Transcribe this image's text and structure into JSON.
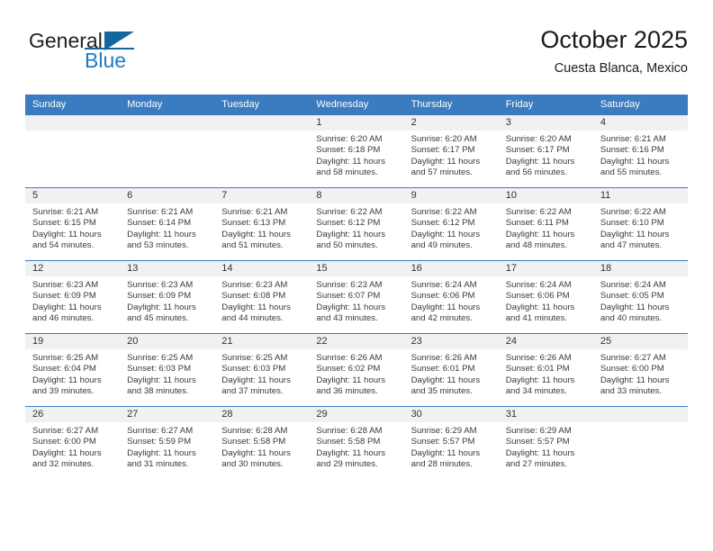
{
  "brand": {
    "name_part1": "General",
    "name_part2": "Blue",
    "flag_icon": "triangle-flag-icon"
  },
  "header": {
    "month_title": "October 2025",
    "location": "Cuesta Blanca, Mexico"
  },
  "colors": {
    "header_blue": "#3b7bbf",
    "brand_blue": "#1f7ac4",
    "daynum_strip": "#f1f1f1",
    "text": "#3a3a3a"
  },
  "weekday_headers": [
    "Sunday",
    "Monday",
    "Tuesday",
    "Wednesday",
    "Thursday",
    "Friday",
    "Saturday"
  ],
  "weeks": [
    [
      {
        "day": "",
        "empty": true
      },
      {
        "day": "",
        "empty": true
      },
      {
        "day": "",
        "empty": true
      },
      {
        "day": "1",
        "sunrise": "Sunrise: 6:20 AM",
        "sunset": "Sunset: 6:18 PM",
        "daylight1": "Daylight: 11 hours",
        "daylight2": "and 58 minutes."
      },
      {
        "day": "2",
        "sunrise": "Sunrise: 6:20 AM",
        "sunset": "Sunset: 6:17 PM",
        "daylight1": "Daylight: 11 hours",
        "daylight2": "and 57 minutes."
      },
      {
        "day": "3",
        "sunrise": "Sunrise: 6:20 AM",
        "sunset": "Sunset: 6:17 PM",
        "daylight1": "Daylight: 11 hours",
        "daylight2": "and 56 minutes."
      },
      {
        "day": "4",
        "sunrise": "Sunrise: 6:21 AM",
        "sunset": "Sunset: 6:16 PM",
        "daylight1": "Daylight: 11 hours",
        "daylight2": "and 55 minutes."
      }
    ],
    [
      {
        "day": "5",
        "sunrise": "Sunrise: 6:21 AM",
        "sunset": "Sunset: 6:15 PM",
        "daylight1": "Daylight: 11 hours",
        "daylight2": "and 54 minutes."
      },
      {
        "day": "6",
        "sunrise": "Sunrise: 6:21 AM",
        "sunset": "Sunset: 6:14 PM",
        "daylight1": "Daylight: 11 hours",
        "daylight2": "and 53 minutes."
      },
      {
        "day": "7",
        "sunrise": "Sunrise: 6:21 AM",
        "sunset": "Sunset: 6:13 PM",
        "daylight1": "Daylight: 11 hours",
        "daylight2": "and 51 minutes."
      },
      {
        "day": "8",
        "sunrise": "Sunrise: 6:22 AM",
        "sunset": "Sunset: 6:12 PM",
        "daylight1": "Daylight: 11 hours",
        "daylight2": "and 50 minutes."
      },
      {
        "day": "9",
        "sunrise": "Sunrise: 6:22 AM",
        "sunset": "Sunset: 6:12 PM",
        "daylight1": "Daylight: 11 hours",
        "daylight2": "and 49 minutes."
      },
      {
        "day": "10",
        "sunrise": "Sunrise: 6:22 AM",
        "sunset": "Sunset: 6:11 PM",
        "daylight1": "Daylight: 11 hours",
        "daylight2": "and 48 minutes."
      },
      {
        "day": "11",
        "sunrise": "Sunrise: 6:22 AM",
        "sunset": "Sunset: 6:10 PM",
        "daylight1": "Daylight: 11 hours",
        "daylight2": "and 47 minutes."
      }
    ],
    [
      {
        "day": "12",
        "sunrise": "Sunrise: 6:23 AM",
        "sunset": "Sunset: 6:09 PM",
        "daylight1": "Daylight: 11 hours",
        "daylight2": "and 46 minutes."
      },
      {
        "day": "13",
        "sunrise": "Sunrise: 6:23 AM",
        "sunset": "Sunset: 6:09 PM",
        "daylight1": "Daylight: 11 hours",
        "daylight2": "and 45 minutes."
      },
      {
        "day": "14",
        "sunrise": "Sunrise: 6:23 AM",
        "sunset": "Sunset: 6:08 PM",
        "daylight1": "Daylight: 11 hours",
        "daylight2": "and 44 minutes."
      },
      {
        "day": "15",
        "sunrise": "Sunrise: 6:23 AM",
        "sunset": "Sunset: 6:07 PM",
        "daylight1": "Daylight: 11 hours",
        "daylight2": "and 43 minutes."
      },
      {
        "day": "16",
        "sunrise": "Sunrise: 6:24 AM",
        "sunset": "Sunset: 6:06 PM",
        "daylight1": "Daylight: 11 hours",
        "daylight2": "and 42 minutes."
      },
      {
        "day": "17",
        "sunrise": "Sunrise: 6:24 AM",
        "sunset": "Sunset: 6:06 PM",
        "daylight1": "Daylight: 11 hours",
        "daylight2": "and 41 minutes."
      },
      {
        "day": "18",
        "sunrise": "Sunrise: 6:24 AM",
        "sunset": "Sunset: 6:05 PM",
        "daylight1": "Daylight: 11 hours",
        "daylight2": "and 40 minutes."
      }
    ],
    [
      {
        "day": "19",
        "sunrise": "Sunrise: 6:25 AM",
        "sunset": "Sunset: 6:04 PM",
        "daylight1": "Daylight: 11 hours",
        "daylight2": "and 39 minutes."
      },
      {
        "day": "20",
        "sunrise": "Sunrise: 6:25 AM",
        "sunset": "Sunset: 6:03 PM",
        "daylight1": "Daylight: 11 hours",
        "daylight2": "and 38 minutes."
      },
      {
        "day": "21",
        "sunrise": "Sunrise: 6:25 AM",
        "sunset": "Sunset: 6:03 PM",
        "daylight1": "Daylight: 11 hours",
        "daylight2": "and 37 minutes."
      },
      {
        "day": "22",
        "sunrise": "Sunrise: 6:26 AM",
        "sunset": "Sunset: 6:02 PM",
        "daylight1": "Daylight: 11 hours",
        "daylight2": "and 36 minutes."
      },
      {
        "day": "23",
        "sunrise": "Sunrise: 6:26 AM",
        "sunset": "Sunset: 6:01 PM",
        "daylight1": "Daylight: 11 hours",
        "daylight2": "and 35 minutes."
      },
      {
        "day": "24",
        "sunrise": "Sunrise: 6:26 AM",
        "sunset": "Sunset: 6:01 PM",
        "daylight1": "Daylight: 11 hours",
        "daylight2": "and 34 minutes."
      },
      {
        "day": "25",
        "sunrise": "Sunrise: 6:27 AM",
        "sunset": "Sunset: 6:00 PM",
        "daylight1": "Daylight: 11 hours",
        "daylight2": "and 33 minutes."
      }
    ],
    [
      {
        "day": "26",
        "sunrise": "Sunrise: 6:27 AM",
        "sunset": "Sunset: 6:00 PM",
        "daylight1": "Daylight: 11 hours",
        "daylight2": "and 32 minutes."
      },
      {
        "day": "27",
        "sunrise": "Sunrise: 6:27 AM",
        "sunset": "Sunset: 5:59 PM",
        "daylight1": "Daylight: 11 hours",
        "daylight2": "and 31 minutes."
      },
      {
        "day": "28",
        "sunrise": "Sunrise: 6:28 AM",
        "sunset": "Sunset: 5:58 PM",
        "daylight1": "Daylight: 11 hours",
        "daylight2": "and 30 minutes."
      },
      {
        "day": "29",
        "sunrise": "Sunrise: 6:28 AM",
        "sunset": "Sunset: 5:58 PM",
        "daylight1": "Daylight: 11 hours",
        "daylight2": "and 29 minutes."
      },
      {
        "day": "30",
        "sunrise": "Sunrise: 6:29 AM",
        "sunset": "Sunset: 5:57 PM",
        "daylight1": "Daylight: 11 hours",
        "daylight2": "and 28 minutes."
      },
      {
        "day": "31",
        "sunrise": "Sunrise: 6:29 AM",
        "sunset": "Sunset: 5:57 PM",
        "daylight1": "Daylight: 11 hours",
        "daylight2": "and 27 minutes."
      },
      {
        "day": "",
        "empty": true
      }
    ]
  ]
}
